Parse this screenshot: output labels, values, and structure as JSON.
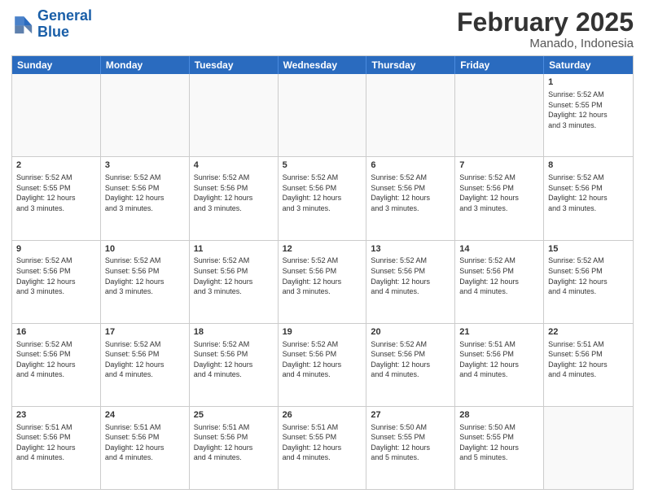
{
  "logo": {
    "text_general": "General",
    "text_blue": "Blue"
  },
  "header": {
    "month": "February 2025",
    "location": "Manado, Indonesia"
  },
  "weekdays": [
    "Sunday",
    "Monday",
    "Tuesday",
    "Wednesday",
    "Thursday",
    "Friday",
    "Saturday"
  ],
  "rows": [
    [
      {
        "day": "",
        "info": ""
      },
      {
        "day": "",
        "info": ""
      },
      {
        "day": "",
        "info": ""
      },
      {
        "day": "",
        "info": ""
      },
      {
        "day": "",
        "info": ""
      },
      {
        "day": "",
        "info": ""
      },
      {
        "day": "1",
        "info": "Sunrise: 5:52 AM\nSunset: 5:55 PM\nDaylight: 12 hours\nand 3 minutes."
      }
    ],
    [
      {
        "day": "2",
        "info": "Sunrise: 5:52 AM\nSunset: 5:55 PM\nDaylight: 12 hours\nand 3 minutes."
      },
      {
        "day": "3",
        "info": "Sunrise: 5:52 AM\nSunset: 5:56 PM\nDaylight: 12 hours\nand 3 minutes."
      },
      {
        "day": "4",
        "info": "Sunrise: 5:52 AM\nSunset: 5:56 PM\nDaylight: 12 hours\nand 3 minutes."
      },
      {
        "day": "5",
        "info": "Sunrise: 5:52 AM\nSunset: 5:56 PM\nDaylight: 12 hours\nand 3 minutes."
      },
      {
        "day": "6",
        "info": "Sunrise: 5:52 AM\nSunset: 5:56 PM\nDaylight: 12 hours\nand 3 minutes."
      },
      {
        "day": "7",
        "info": "Sunrise: 5:52 AM\nSunset: 5:56 PM\nDaylight: 12 hours\nand 3 minutes."
      },
      {
        "day": "8",
        "info": "Sunrise: 5:52 AM\nSunset: 5:56 PM\nDaylight: 12 hours\nand 3 minutes."
      }
    ],
    [
      {
        "day": "9",
        "info": "Sunrise: 5:52 AM\nSunset: 5:56 PM\nDaylight: 12 hours\nand 3 minutes."
      },
      {
        "day": "10",
        "info": "Sunrise: 5:52 AM\nSunset: 5:56 PM\nDaylight: 12 hours\nand 3 minutes."
      },
      {
        "day": "11",
        "info": "Sunrise: 5:52 AM\nSunset: 5:56 PM\nDaylight: 12 hours\nand 3 minutes."
      },
      {
        "day": "12",
        "info": "Sunrise: 5:52 AM\nSunset: 5:56 PM\nDaylight: 12 hours\nand 3 minutes."
      },
      {
        "day": "13",
        "info": "Sunrise: 5:52 AM\nSunset: 5:56 PM\nDaylight: 12 hours\nand 4 minutes."
      },
      {
        "day": "14",
        "info": "Sunrise: 5:52 AM\nSunset: 5:56 PM\nDaylight: 12 hours\nand 4 minutes."
      },
      {
        "day": "15",
        "info": "Sunrise: 5:52 AM\nSunset: 5:56 PM\nDaylight: 12 hours\nand 4 minutes."
      }
    ],
    [
      {
        "day": "16",
        "info": "Sunrise: 5:52 AM\nSunset: 5:56 PM\nDaylight: 12 hours\nand 4 minutes."
      },
      {
        "day": "17",
        "info": "Sunrise: 5:52 AM\nSunset: 5:56 PM\nDaylight: 12 hours\nand 4 minutes."
      },
      {
        "day": "18",
        "info": "Sunrise: 5:52 AM\nSunset: 5:56 PM\nDaylight: 12 hours\nand 4 minutes."
      },
      {
        "day": "19",
        "info": "Sunrise: 5:52 AM\nSunset: 5:56 PM\nDaylight: 12 hours\nand 4 minutes."
      },
      {
        "day": "20",
        "info": "Sunrise: 5:52 AM\nSunset: 5:56 PM\nDaylight: 12 hours\nand 4 minutes."
      },
      {
        "day": "21",
        "info": "Sunrise: 5:51 AM\nSunset: 5:56 PM\nDaylight: 12 hours\nand 4 minutes."
      },
      {
        "day": "22",
        "info": "Sunrise: 5:51 AM\nSunset: 5:56 PM\nDaylight: 12 hours\nand 4 minutes."
      }
    ],
    [
      {
        "day": "23",
        "info": "Sunrise: 5:51 AM\nSunset: 5:56 PM\nDaylight: 12 hours\nand 4 minutes."
      },
      {
        "day": "24",
        "info": "Sunrise: 5:51 AM\nSunset: 5:56 PM\nDaylight: 12 hours\nand 4 minutes."
      },
      {
        "day": "25",
        "info": "Sunrise: 5:51 AM\nSunset: 5:56 PM\nDaylight: 12 hours\nand 4 minutes."
      },
      {
        "day": "26",
        "info": "Sunrise: 5:51 AM\nSunset: 5:55 PM\nDaylight: 12 hours\nand 4 minutes."
      },
      {
        "day": "27",
        "info": "Sunrise: 5:50 AM\nSunset: 5:55 PM\nDaylight: 12 hours\nand 5 minutes."
      },
      {
        "day": "28",
        "info": "Sunrise: 5:50 AM\nSunset: 5:55 PM\nDaylight: 12 hours\nand 5 minutes."
      },
      {
        "day": "",
        "info": ""
      }
    ]
  ]
}
